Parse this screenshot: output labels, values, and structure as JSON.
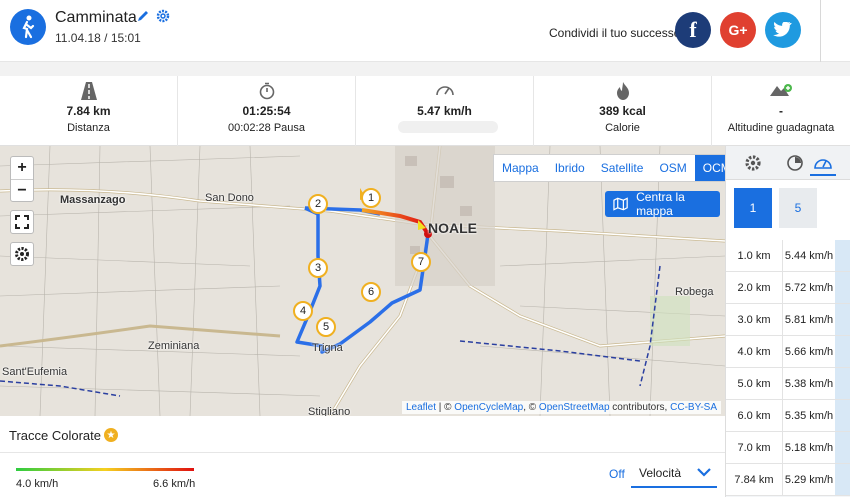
{
  "header": {
    "title": "Camminata",
    "date": "11.04.18 / 15:01",
    "share_label": "Condividi il tuo successo",
    "social": {
      "facebook": "f",
      "google": "G+"
    }
  },
  "stats": [
    {
      "icon": "road-icon",
      "value": "7.84 km",
      "label": "Distanza"
    },
    {
      "icon": "stopwatch-icon",
      "value": "01:25:54",
      "label": "00:02:28 Pausa"
    },
    {
      "icon": "speedometer-icon",
      "value": "5.47 km/h",
      "label": ""
    },
    {
      "icon": "flame-icon",
      "value": "389 kcal",
      "label": "Calorie"
    },
    {
      "icon": "mountain-up-icon",
      "value": "-",
      "label": "Altitudine guadagnata"
    }
  ],
  "map": {
    "zoom_in": "+",
    "zoom_out": "−",
    "layers": [
      "Mappa",
      "Ibrido",
      "Satellite",
      "OSM",
      "OCM"
    ],
    "active_layer": "OCM",
    "center_button": "Centra la mappa",
    "markers": [
      "1",
      "2",
      "3",
      "4",
      "5",
      "6",
      "7"
    ],
    "towns": [
      "Massanzago",
      "San Dono",
      "Zeminiana",
      "Sant'Eufemia",
      "Stigliano",
      "Robega",
      "NOALE"
    ],
    "town_partial": "Trigna",
    "attribution": {
      "leaflet": "Leaflet",
      "sep1": " | © ",
      "opencyclemap": "OpenCycleMap",
      "sep2": ", © ",
      "osm": "OpenStreetMap",
      "contrib": " contributors, ",
      "license": "CC-BY-SA"
    }
  },
  "panel": {
    "pages": [
      "1",
      "5"
    ],
    "splits": [
      {
        "km": "1.0 km",
        "speed": "5.44 km/h"
      },
      {
        "km": "2.0 km",
        "speed": "5.72 km/h"
      },
      {
        "km": "3.0 km",
        "speed": "5.81 km/h"
      },
      {
        "km": "4.0 km",
        "speed": "5.66 km/h"
      },
      {
        "km": "5.0 km",
        "speed": "5.38 km/h"
      },
      {
        "km": "6.0 km",
        "speed": "5.35 km/h"
      },
      {
        "km": "7.0 km",
        "speed": "5.18 km/h"
      },
      {
        "km": "7.84 km",
        "speed": "5.29 km/h"
      }
    ]
  },
  "colored_tracks": {
    "title": "Tracce Colorate",
    "min": "4.0 km/h",
    "max": "6.6 km/h",
    "off_label": "Off",
    "selected": "Velocità"
  },
  "colors": {
    "accent": "#1a6fe0",
    "facebook": "#1d3c78",
    "google": "#e04030",
    "twitter": "#1f9ae0"
  }
}
